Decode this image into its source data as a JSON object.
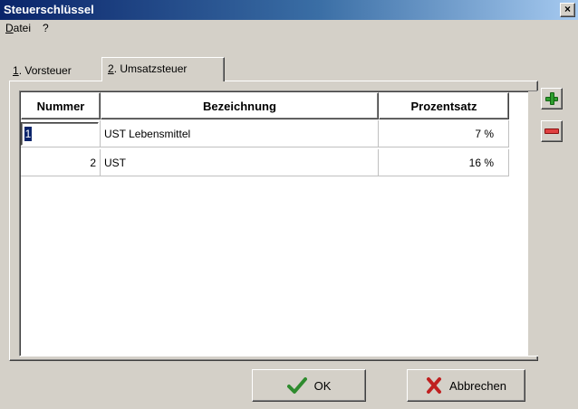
{
  "window": {
    "title": "Steuerschlüssel",
    "close_symbol": "×"
  },
  "menu": [
    {
      "label": "Datei",
      "mnemonic": "D"
    },
    {
      "label": "?"
    }
  ],
  "tabs": [
    {
      "number": "1",
      "label": ". Vorsteuer",
      "active": false
    },
    {
      "number": "2",
      "label": ". Umsatzsteuer",
      "active": true
    }
  ],
  "table": {
    "columns": [
      "Nummer",
      "Bezeichnung",
      "Prozentsatz"
    ],
    "rows": [
      {
        "nummer": "1",
        "bezeichnung": "UST Lebensmittel",
        "prozentsatz": "7 %"
      },
      {
        "nummer": "2",
        "bezeichnung": "UST",
        "prozentsatz": "16 %"
      }
    ]
  },
  "side_buttons": [
    {
      "icon": "plus-icon"
    },
    {
      "icon": "minus-icon"
    }
  ],
  "buttons": {
    "ok": {
      "label": "OK",
      "icon": "check-icon",
      "color": "#2e8b2e"
    },
    "cancel": {
      "label": "Abbrechen",
      "icon": "x-icon",
      "color": "#c02020"
    }
  }
}
